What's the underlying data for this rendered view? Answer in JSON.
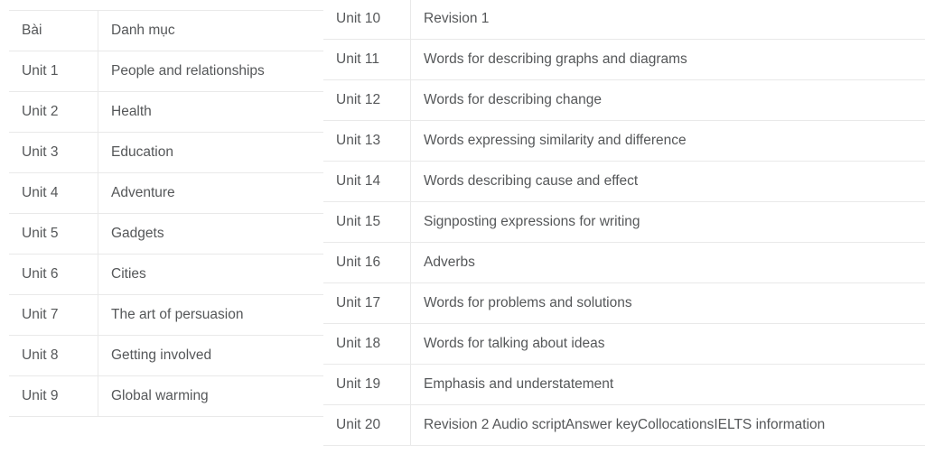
{
  "left_table": {
    "name": "contents-table-units-1-9",
    "columns": [
      "Bài",
      "Danh mục"
    ],
    "header": {
      "unit": "Bài",
      "topic": "Danh mục"
    },
    "rows": [
      {
        "unit": "Unit 1",
        "topic": "People and relationships"
      },
      {
        "unit": "Unit 2",
        "topic": "Health"
      },
      {
        "unit": "Unit 3",
        "topic": "Education"
      },
      {
        "unit": "Unit 4",
        "topic": "Adventure"
      },
      {
        "unit": "Unit 5",
        "topic": "Gadgets"
      },
      {
        "unit": "Unit 6",
        "topic": "Cities"
      },
      {
        "unit": "Unit 7",
        "topic": "The art of persuasion"
      },
      {
        "unit": "Unit 8",
        "topic": "Getting involved"
      },
      {
        "unit": "Unit 9",
        "topic": "Global warming"
      }
    ]
  },
  "right_table": {
    "name": "contents-table-units-10-20",
    "rows": [
      {
        "unit": "Unit 10",
        "topic": "Revision 1"
      },
      {
        "unit": "Unit 11",
        "topic": "Words for describing graphs and diagrams"
      },
      {
        "unit": "Unit 12",
        "topic": "Words for describing change"
      },
      {
        "unit": "Unit 13",
        "topic": "Words expressing similarity and difference"
      },
      {
        "unit": "Unit 14",
        "topic": "Words describing cause and effect"
      },
      {
        "unit": "Unit 15",
        "topic": "Signposting expressions for writing"
      },
      {
        "unit": "Unit 16",
        "topic": "Adverbs"
      },
      {
        "unit": "Unit 17",
        "topic": "Words for problems and solutions"
      },
      {
        "unit": "Unit 18",
        "topic": "Words for talking about ideas"
      },
      {
        "unit": "Unit 19",
        "topic": "Emphasis and understatement"
      },
      {
        "unit": "Unit 20",
        "topic": "Revision 2 Audio scriptAnswer keyCollocationsIELTS information"
      }
    ]
  },
  "style": {
    "text_color": "#555759",
    "border_color": "#e9e9e9",
    "background_color": "#ffffff"
  }
}
